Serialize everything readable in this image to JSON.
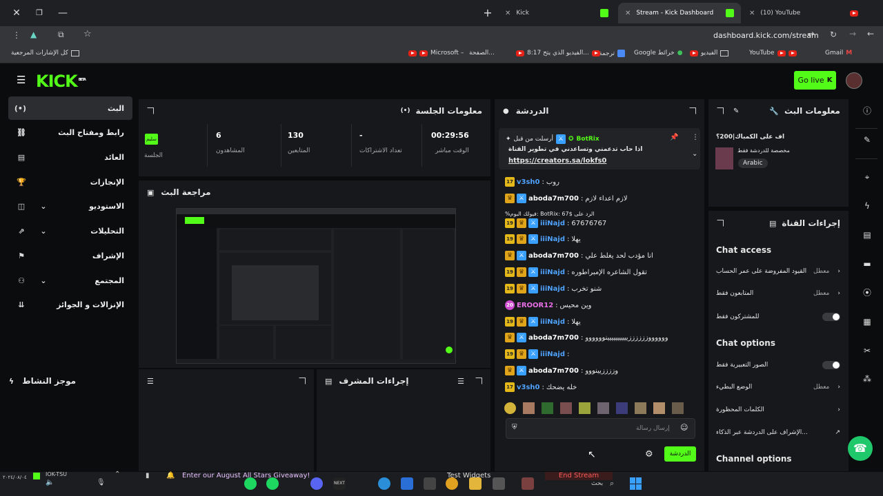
{
  "browser": {
    "tabs": [
      {
        "label": "Kick",
        "active": false
      },
      {
        "label": "Stream - Kick Dashboard",
        "active": true
      },
      {
        "label": "(10) YouTube",
        "active": false
      }
    ],
    "url": "dashboard.kick.com/stream",
    "bookmarks": [
      "Gmail",
      "YouTube",
      "الفيديو",
      "Google خرائط",
      "ترجمة",
      "8:17 الفيديو الذي يتح...",
      "الصفحة...",
      "Microsoft –",
      "كل الإشارات المرجعية"
    ]
  },
  "header": {
    "logo": "KICK",
    "logo_badge": "BETA",
    "golive_label": "Go live"
  },
  "sidebar": {
    "items": [
      {
        "label": "البث",
        "icon": "(•)"
      },
      {
        "label": "رابط ومفتاح البث",
        "icon": "⛓"
      },
      {
        "label": "العائد",
        "icon": "▤"
      },
      {
        "label": "الإنجازات",
        "icon": "🏆"
      },
      {
        "label": "الاستوديو",
        "icon": "◫"
      },
      {
        "label": "التحليلات",
        "icon": "⇗"
      },
      {
        "label": "الإشراف",
        "icon": "⚑"
      },
      {
        "label": "المجتمع",
        "icon": "⚇"
      },
      {
        "label": "الإنزالات و الجوائز",
        "icon": "⇊"
      }
    ]
  },
  "session": {
    "title": "معلومات الجلسة",
    "status_badge": "سليم",
    "status_label": "الجلسة",
    "stats": [
      {
        "value": "6",
        "label": "المشاهدون"
      },
      {
        "value": "130",
        "label": "المتابعين"
      },
      {
        "value": "-",
        "label": "تعداد الاشتراكات"
      },
      {
        "value": "00:29:56",
        "label": "الوقت مباشر"
      }
    ]
  },
  "preview": {
    "title": "مراجعة البث"
  },
  "activity": {
    "title": "موجز النشاط"
  },
  "modactions": {
    "title": "إجراءات المشرف"
  },
  "chat": {
    "title": "الدردشة",
    "pinned": {
      "by": "أرسلت من قبل",
      "user": "BotRix",
      "text": "اذا حاب تدعمني وتساعدني في تطوير القناة",
      "link": "https://creators.sa/lokfs0"
    },
    "messages": [
      {
        "badge": "17",
        "user": "v3sh0",
        "color": "#4fa3ff",
        "text": "روب"
      },
      {
        "badge": "",
        "user": "aboda7m700",
        "color": "#ffffff",
        "text": "لازم اعداء لازم"
      },
      {
        "badge": "",
        "user": "",
        "color": "#888888",
        "text": "%فيولك البوم: BotRix: 67$ الرد على"
      },
      {
        "badge": "19",
        "user": "iiiNajd",
        "color": "#4fa3ff",
        "text": "67676767"
      },
      {
        "badge": "19",
        "user": "iiiNajd",
        "color": "#4fa3ff",
        "text": "يهلا"
      },
      {
        "badge": "",
        "user": "aboda7m700",
        "color": "#ffffff",
        "text": "انا مؤدب لحد يغلط علي"
      },
      {
        "badge": "19",
        "user": "iiiNajd",
        "color": "#4fa3ff",
        "text": "تقول الشاعره الإمبراطوره"
      },
      {
        "badge": "19",
        "user": "iiiNajd",
        "color": "#4fa3ff",
        "text": "شنو تخرب"
      },
      {
        "badge": "20",
        "user": "EROOR12",
        "color": "#e86fe8",
        "text": "وين محيس"
      },
      {
        "badge": "19",
        "user": "iiiNajd",
        "color": "#4fa3ff",
        "text": "يهلا"
      },
      {
        "badge": "",
        "user": "aboda7m700",
        "color": "#ffffff",
        "text": "ووووووززززززيييييييييينوووووو"
      },
      {
        "badge": "19",
        "user": "iiiNajd",
        "color": "#4fa3ff",
        "text": ""
      },
      {
        "badge": "",
        "user": "aboda7m700",
        "color": "#ffffff",
        "text": "وززززيينووو"
      },
      {
        "badge": "17",
        "user": "v3sh0",
        "color": "#4fa3ff",
        "text": "خله يضحك"
      }
    ],
    "input_placeholder": "إرسال رسالة",
    "send_label": "الدردشة"
  },
  "stream_info": {
    "title": "معلومات البث",
    "stream_title": "اف على الكمباك|200؟",
    "category": "مخصصة للدردشة فقط",
    "language": "Arabic"
  },
  "channel_actions": {
    "title": "إجراءات القناة",
    "chat_access_heading": "Chat access",
    "chat_access": [
      {
        "label": "القيود المفروضة على عمر الحساب",
        "value": "معطل",
        "control": "chevron"
      },
      {
        "label": "المتابعون فقط",
        "value": "معطل",
        "control": "chevron"
      },
      {
        "label": "للمشتركون فقط",
        "value": "",
        "control": "toggle"
      }
    ],
    "chat_options_heading": "Chat options",
    "chat_options": [
      {
        "label": "الصور التعبيرية فقط",
        "value": "",
        "control": "toggle"
      },
      {
        "label": "الوضع البطيء",
        "value": "معطل",
        "control": "chevron"
      },
      {
        "label": "الكلمات المحظورة",
        "value": "",
        "control": "chevron"
      },
      {
        "label": "الإشراف على الدردشة عبر الذكاء...",
        "value": "",
        "control": "external"
      }
    ],
    "channel_options_heading": "Channel options"
  },
  "taskbar": {
    "left_text": "Enter our August All Stars Giveaway!",
    "test_widgets": "Test Widgets",
    "end_stream": "End Stream",
    "search": "بحث",
    "tray_user": "IOK-TSU",
    "date": "٢٠٢٤/٠٨/٠٤"
  },
  "colors": {
    "accent": "#53fc18",
    "panel": "#17181b",
    "bg": "#0b0c0e"
  }
}
